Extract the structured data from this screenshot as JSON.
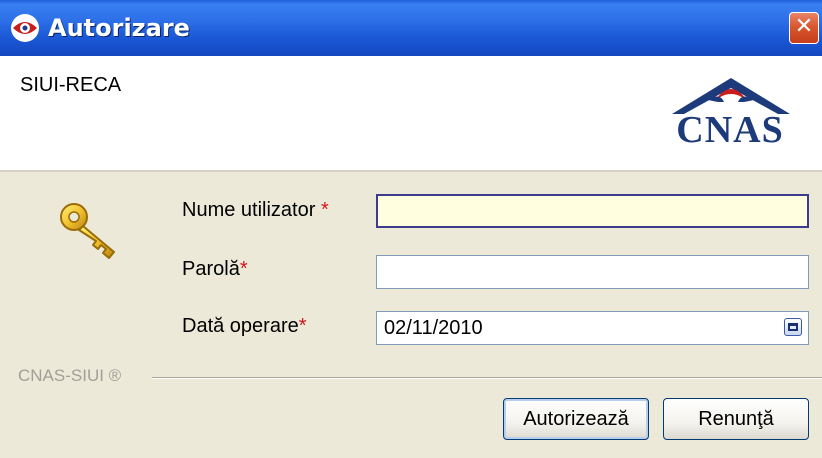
{
  "window": {
    "title": "Autorizare",
    "close_symbol": "✕"
  },
  "header": {
    "app_name": "SIUI-RECA",
    "logo_text": "CNAS"
  },
  "form": {
    "username": {
      "label": "Nume utilizator",
      "required_mark": "*",
      "value": ""
    },
    "password": {
      "label": "Parolă",
      "required_mark": "*",
      "value": ""
    },
    "date": {
      "label": "Dată operare",
      "required_mark": "*",
      "value": "02/11/2010"
    }
  },
  "footer": {
    "label": "CNAS-SIUI ®"
  },
  "buttons": {
    "ok_label": "Autorizează",
    "cancel_label": "Renunţă"
  },
  "colors": {
    "titlebar": "#2a6de6",
    "required": "#d0161b",
    "username_bg": "#ffffe0",
    "logo": "#1d3a7a"
  },
  "icons": {
    "title": "eye-icon",
    "key": "key-icon",
    "close": "close-icon",
    "date_picker": "calendar-icon"
  }
}
